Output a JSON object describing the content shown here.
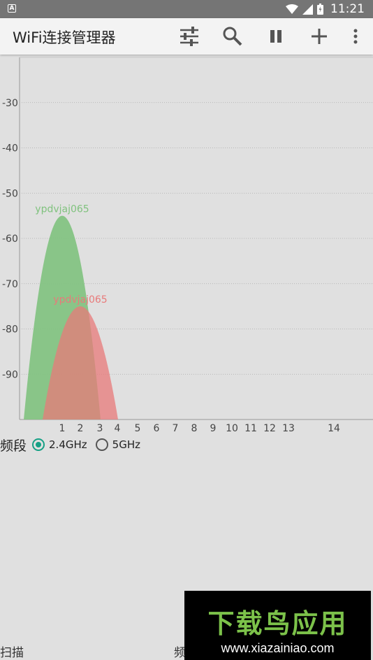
{
  "status_bar": {
    "time": "11:21"
  },
  "app_bar": {
    "title": "WiFi连接管理器",
    "actions": [
      "filter-icon",
      "search-icon",
      "pause-icon",
      "add-icon",
      "overflow-menu-icon"
    ]
  },
  "chart_data": {
    "type": "area",
    "ylim": [
      -100,
      -20
    ],
    "y_ticks": [
      "-30",
      "-40",
      "-50",
      "-60",
      "-70",
      "-80",
      "-90"
    ],
    "x_ticks": [
      "1",
      "2",
      "3",
      "4",
      "5",
      "6",
      "7",
      "8",
      "9",
      "10",
      "11",
      "12",
      "13",
      "14"
    ],
    "grid": true,
    "series": [
      {
        "name": "ypdvjaj065",
        "channel": 1,
        "signal_dbm": -55,
        "color": "#80c27e"
      },
      {
        "name": "ypdvjaj065",
        "channel": 2,
        "signal_dbm": -75,
        "color": "#e87a7a"
      }
    ]
  },
  "band_selector": {
    "label": "频段",
    "options": [
      {
        "label": "2.4GHz",
        "checked": true
      },
      {
        "label": "5GHz",
        "checked": false
      }
    ]
  },
  "bottom_nav": {
    "scan": "扫描",
    "freq": "频"
  },
  "watermark": {
    "brand": "下载鸟应用",
    "url": "www.xiazainiao.com"
  }
}
